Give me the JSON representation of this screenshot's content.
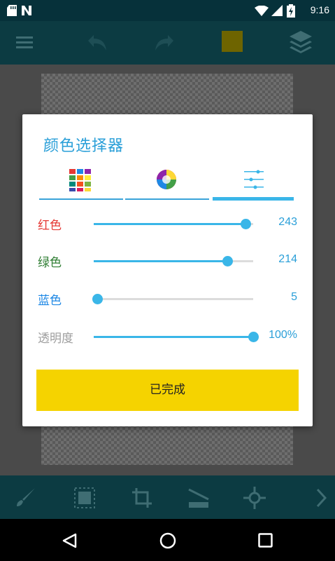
{
  "status_bar": {
    "time": "9:16",
    "notification_icons": [
      "sd-card-icon",
      "n-logo-icon"
    ],
    "system_icons": [
      "wifi-icon",
      "cell-signal-icon",
      "battery-icon"
    ]
  },
  "toolbar": {
    "icons": [
      "menu-icon",
      "undo-icon",
      "redo-icon",
      "color-swatch-icon",
      "layers-icon"
    ],
    "swatch_color": "#c8a800"
  },
  "dialog": {
    "title": "颜色选择器",
    "tabs": [
      {
        "icon": "color-grid-icon",
        "active": false
      },
      {
        "icon": "color-wheel-icon",
        "active": false
      },
      {
        "icon": "sliders-icon",
        "active": true
      }
    ],
    "sliders": [
      {
        "label": "红色",
        "value": "243",
        "level": 0.953,
        "color": "#e53935"
      },
      {
        "label": "绿色",
        "value": "214",
        "level": 0.839,
        "color": "#2e7d32"
      },
      {
        "label": "蓝色",
        "value": "5",
        "level": 0.02,
        "color": "#1e88e5"
      },
      {
        "label": "透明度",
        "value": "100%",
        "level": 1.0,
        "color": "#9e9e9e"
      }
    ],
    "done_label": "已完成",
    "done_color": "#f5d300"
  },
  "bottom_tools": [
    "brush-icon",
    "selection-icon",
    "rotate-crop-icon",
    "ruler-icon",
    "transform-icon",
    "chevron-right-icon"
  ],
  "nav_bar": [
    "back-icon",
    "home-icon",
    "recents-icon"
  ],
  "accent_color": "#3ab6e8"
}
